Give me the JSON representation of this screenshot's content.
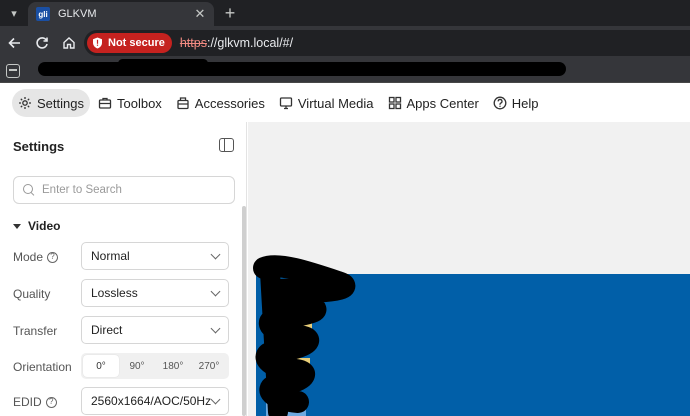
{
  "browser": {
    "tab_title": "GLKVM",
    "favicon_text": "gli",
    "security_label": "Not secure",
    "url_protocol": "https",
    "url_rest": "://glkvm.local/#/"
  },
  "app_nav": {
    "items": [
      {
        "label": "Settings",
        "icon": "gear-icon",
        "active": true
      },
      {
        "label": "Toolbox",
        "icon": "toolbox-icon"
      },
      {
        "label": "Accessories",
        "icon": "bag-icon"
      },
      {
        "label": "Virtual Media",
        "icon": "monitor-icon"
      },
      {
        "label": "Apps Center",
        "icon": "apps-grid-icon"
      },
      {
        "label": "Help",
        "icon": "question-icon"
      }
    ]
  },
  "settings": {
    "title": "Settings",
    "search_placeholder": "Enter to Search",
    "section": "Video",
    "mode": {
      "label": "Mode",
      "value": "Normal"
    },
    "quality": {
      "label": "Quality",
      "value": "Lossless"
    },
    "transfer": {
      "label": "Transfer",
      "value": "Direct"
    },
    "orientation": {
      "label": "Orientation",
      "options": [
        "0°",
        "90°",
        "180°",
        "270°"
      ],
      "selected": "0°"
    },
    "edid": {
      "label": "EDID",
      "value": "2560x1664/AOC/50Hz"
    }
  },
  "colors": {
    "accent_red": "#c5221f",
    "remote_desktop_blue": "#015fa8"
  }
}
